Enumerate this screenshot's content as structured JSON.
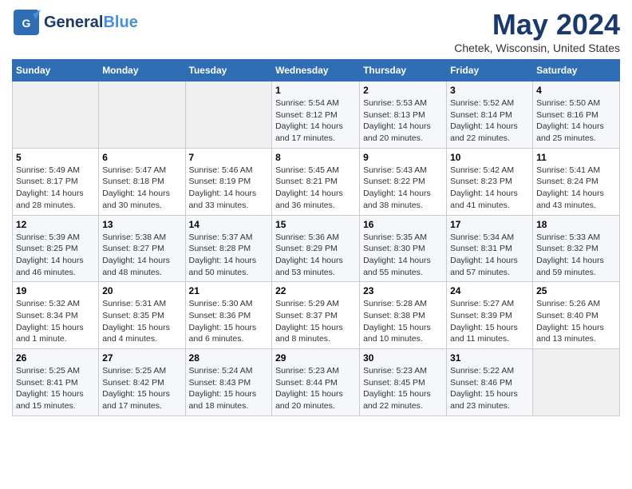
{
  "header": {
    "logo_general": "General",
    "logo_blue": "Blue",
    "main_title": "May 2024",
    "subtitle": "Chetek, Wisconsin, United States"
  },
  "days_of_week": [
    "Sunday",
    "Monday",
    "Tuesday",
    "Wednesday",
    "Thursday",
    "Friday",
    "Saturday"
  ],
  "weeks": [
    [
      {
        "day": "",
        "info": ""
      },
      {
        "day": "",
        "info": ""
      },
      {
        "day": "",
        "info": ""
      },
      {
        "day": "1",
        "info": "Sunrise: 5:54 AM\nSunset: 8:12 PM\nDaylight: 14 hours\nand 17 minutes."
      },
      {
        "day": "2",
        "info": "Sunrise: 5:53 AM\nSunset: 8:13 PM\nDaylight: 14 hours\nand 20 minutes."
      },
      {
        "day": "3",
        "info": "Sunrise: 5:52 AM\nSunset: 8:14 PM\nDaylight: 14 hours\nand 22 minutes."
      },
      {
        "day": "4",
        "info": "Sunrise: 5:50 AM\nSunset: 8:16 PM\nDaylight: 14 hours\nand 25 minutes."
      }
    ],
    [
      {
        "day": "5",
        "info": "Sunrise: 5:49 AM\nSunset: 8:17 PM\nDaylight: 14 hours\nand 28 minutes."
      },
      {
        "day": "6",
        "info": "Sunrise: 5:47 AM\nSunset: 8:18 PM\nDaylight: 14 hours\nand 30 minutes."
      },
      {
        "day": "7",
        "info": "Sunrise: 5:46 AM\nSunset: 8:19 PM\nDaylight: 14 hours\nand 33 minutes."
      },
      {
        "day": "8",
        "info": "Sunrise: 5:45 AM\nSunset: 8:21 PM\nDaylight: 14 hours\nand 36 minutes."
      },
      {
        "day": "9",
        "info": "Sunrise: 5:43 AM\nSunset: 8:22 PM\nDaylight: 14 hours\nand 38 minutes."
      },
      {
        "day": "10",
        "info": "Sunrise: 5:42 AM\nSunset: 8:23 PM\nDaylight: 14 hours\nand 41 minutes."
      },
      {
        "day": "11",
        "info": "Sunrise: 5:41 AM\nSunset: 8:24 PM\nDaylight: 14 hours\nand 43 minutes."
      }
    ],
    [
      {
        "day": "12",
        "info": "Sunrise: 5:39 AM\nSunset: 8:25 PM\nDaylight: 14 hours\nand 46 minutes."
      },
      {
        "day": "13",
        "info": "Sunrise: 5:38 AM\nSunset: 8:27 PM\nDaylight: 14 hours\nand 48 minutes."
      },
      {
        "day": "14",
        "info": "Sunrise: 5:37 AM\nSunset: 8:28 PM\nDaylight: 14 hours\nand 50 minutes."
      },
      {
        "day": "15",
        "info": "Sunrise: 5:36 AM\nSunset: 8:29 PM\nDaylight: 14 hours\nand 53 minutes."
      },
      {
        "day": "16",
        "info": "Sunrise: 5:35 AM\nSunset: 8:30 PM\nDaylight: 14 hours\nand 55 minutes."
      },
      {
        "day": "17",
        "info": "Sunrise: 5:34 AM\nSunset: 8:31 PM\nDaylight: 14 hours\nand 57 minutes."
      },
      {
        "day": "18",
        "info": "Sunrise: 5:33 AM\nSunset: 8:32 PM\nDaylight: 14 hours\nand 59 minutes."
      }
    ],
    [
      {
        "day": "19",
        "info": "Sunrise: 5:32 AM\nSunset: 8:34 PM\nDaylight: 15 hours\nand 1 minute."
      },
      {
        "day": "20",
        "info": "Sunrise: 5:31 AM\nSunset: 8:35 PM\nDaylight: 15 hours\nand 4 minutes."
      },
      {
        "day": "21",
        "info": "Sunrise: 5:30 AM\nSunset: 8:36 PM\nDaylight: 15 hours\nand 6 minutes."
      },
      {
        "day": "22",
        "info": "Sunrise: 5:29 AM\nSunset: 8:37 PM\nDaylight: 15 hours\nand 8 minutes."
      },
      {
        "day": "23",
        "info": "Sunrise: 5:28 AM\nSunset: 8:38 PM\nDaylight: 15 hours\nand 10 minutes."
      },
      {
        "day": "24",
        "info": "Sunrise: 5:27 AM\nSunset: 8:39 PM\nDaylight: 15 hours\nand 11 minutes."
      },
      {
        "day": "25",
        "info": "Sunrise: 5:26 AM\nSunset: 8:40 PM\nDaylight: 15 hours\nand 13 minutes."
      }
    ],
    [
      {
        "day": "26",
        "info": "Sunrise: 5:25 AM\nSunset: 8:41 PM\nDaylight: 15 hours\nand 15 minutes."
      },
      {
        "day": "27",
        "info": "Sunrise: 5:25 AM\nSunset: 8:42 PM\nDaylight: 15 hours\nand 17 minutes."
      },
      {
        "day": "28",
        "info": "Sunrise: 5:24 AM\nSunset: 8:43 PM\nDaylight: 15 hours\nand 18 minutes."
      },
      {
        "day": "29",
        "info": "Sunrise: 5:23 AM\nSunset: 8:44 PM\nDaylight: 15 hours\nand 20 minutes."
      },
      {
        "day": "30",
        "info": "Sunrise: 5:23 AM\nSunset: 8:45 PM\nDaylight: 15 hours\nand 22 minutes."
      },
      {
        "day": "31",
        "info": "Sunrise: 5:22 AM\nSunset: 8:46 PM\nDaylight: 15 hours\nand 23 minutes."
      },
      {
        "day": "",
        "info": ""
      }
    ]
  ]
}
